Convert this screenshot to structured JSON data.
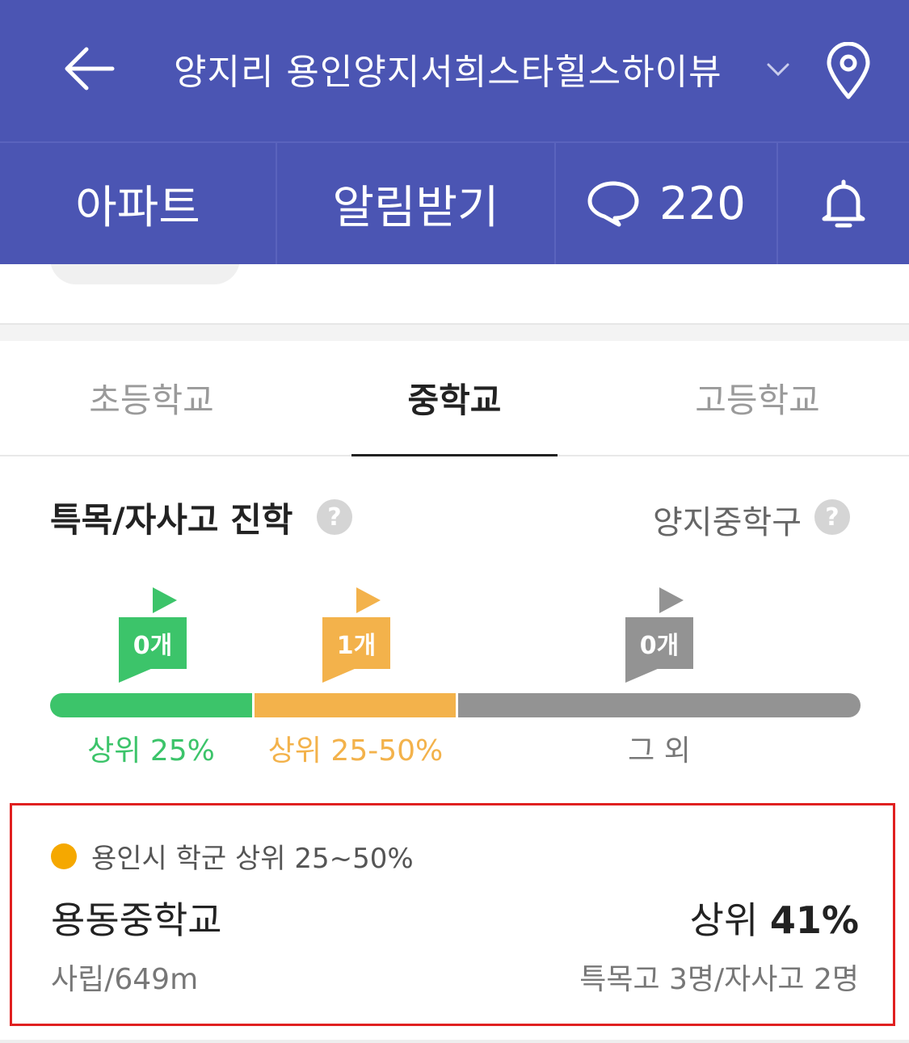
{
  "header": {
    "title": "양지리 용인양지서희스타힐스하이뷰",
    "tabs": {
      "apartment": "아파트",
      "alarm": "알림받기",
      "comments_count": "220"
    },
    "icons": [
      "back-arrow-icon",
      "chevron-down-icon",
      "location-pin-icon",
      "speech-bubble-icon",
      "bell-icon"
    ],
    "bg_color": "#4b55b3"
  },
  "school_tabs": [
    {
      "label": "초등학교",
      "active": false
    },
    {
      "label": "중학교",
      "active": true
    },
    {
      "label": "고등학교",
      "active": false
    }
  ],
  "section": {
    "title": "특목/자사고 진학",
    "district": "양지중학구",
    "help": "?"
  },
  "ranking_bar": {
    "segments": [
      {
        "label": "상위 25%",
        "count": "0개",
        "color": "#3cc46a"
      },
      {
        "label": "상위 25-50%",
        "count": "1개",
        "color": "#f3b24b"
      },
      {
        "label": "그 외",
        "count": "0개",
        "color": "#939393"
      }
    ]
  },
  "school_card": {
    "category": "용인시 학군 상위 25~50%",
    "name": "용동중학교",
    "rank_prefix": "상위",
    "rank_value": "41%",
    "meta": "사립/649m",
    "stats": "특목고 3명/자사고 2명",
    "dot_color": "#f5a800"
  }
}
